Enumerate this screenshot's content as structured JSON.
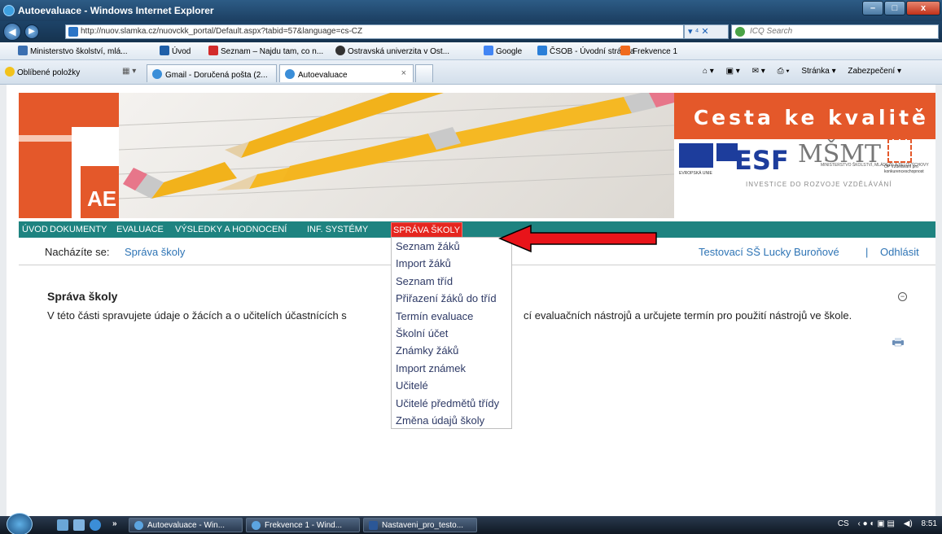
{
  "window": {
    "title": "Autoevaluace - Windows Internet Explorer",
    "buttons": {
      "minimize": "–",
      "maximize": "□",
      "close": "x"
    }
  },
  "address": {
    "url": "http://nuov.slamka.cz/nuovckk_portal/Default.aspx?tabid=57&language=cs-CZ",
    "search_placeholder": "ICQ Search"
  },
  "favorites_bar": {
    "items": [
      "Ministerstvo školství, mlá...",
      "Úvod",
      "Seznam – Najdu tam, co n...",
      "Ostravská univerzita v Ost...",
      "Google",
      "ČSOB - Úvodní stránka",
      "Frekvence 1"
    ]
  },
  "tabs_row": {
    "favorites_label": "Oblíbené položky",
    "tabs": [
      {
        "label": "Gmail - Doručená pošta (2...",
        "active": false
      },
      {
        "label": "Autoevaluace",
        "active": true
      }
    ],
    "command_bar": {
      "page": "Stránka ▾",
      "security": "Zabezpečení ▾"
    }
  },
  "banner": {
    "logo_text": "AE",
    "slogan": "Cesta ke kvalitě",
    "eu_caption": "EVROPSKÁ UNIE",
    "esf_text": "ESF",
    "msmt_text": "MŠMT",
    "msmt_caption": "MINISTERSTVO ŠKOLSTVÍ, MLÁDEŽE A TĚLOVÝCHOVY",
    "op_caption": "OP Vzdělávání pro konkurenceschopnost",
    "investice": "INVESTICE DO ROZVOJE VZDĚLÁVÁNÍ"
  },
  "menu": {
    "items": [
      "ÚVOD",
      "DOKUMENTY",
      "EVALUACE",
      "VÝSLEDKY A HODNOCENÍ",
      "INF. SYSTÉMY",
      "SPRÁVA ŠKOLY"
    ],
    "active": "SPRÁVA ŠKOLY"
  },
  "breadcrumb": {
    "label": "Nacházíte se:",
    "current": "Správa školy",
    "user": "Testovací SŠ Lucky Buroňové",
    "separator": "|",
    "logout": "Odhlásit"
  },
  "content": {
    "title": "Správa školy",
    "text_left": "V této části spravujete údaje o žácích a o učitelích účastnících s",
    "text_right": "cí evaluačních nástrojů a určujete termín pro použití nástrojů ve škole."
  },
  "dropdown": {
    "items": [
      "Seznam žáků",
      "Import žáků",
      "Seznam tříd",
      "Přiřazení žáků do tříd",
      "Termín evaluace",
      "Školní účet",
      "Známky žáků",
      "Import známek",
      "Učitelé",
      "Učitelé předmětů třídy",
      "Změna údajů školy"
    ]
  },
  "taskbar": {
    "buttons": [
      "Autoevaluace - Win...",
      "Frekvence 1 - Wind...",
      "Nastaveni_pro_testo..."
    ],
    "language": "CS",
    "time": "8:51"
  },
  "colors": {
    "menu_bg": "#1e8380",
    "active_menu": "#e5261f",
    "brand_orange": "#e4582a",
    "link": "#2e74b5",
    "arrow": "#e8141a"
  }
}
